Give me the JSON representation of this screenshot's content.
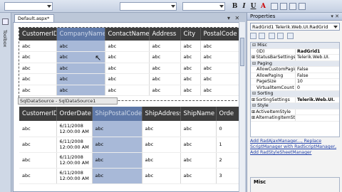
{
  "toolbar": {
    "format_buttons": [
      "B",
      "I",
      "U",
      "A"
    ]
  },
  "toolbox": {
    "label": "Toolbox"
  },
  "document": {
    "tab_title": "Default.aspx*",
    "window_controls": "▾ ✕"
  },
  "grid1": {
    "columns": [
      "CustomerID",
      "CompanyName",
      "ContactName",
      "Address",
      "City",
      "PostalCode"
    ],
    "selected_column": 1,
    "rows": [
      [
        "abc",
        "abc",
        "abc",
        "abc",
        "abc",
        "abc"
      ],
      [
        "abc",
        "abc",
        "abc",
        "abc",
        "abc",
        "abc"
      ],
      [
        "abc",
        "abc",
        "abc",
        "abc",
        "abc",
        "abc"
      ],
      [
        "abc",
        "abc",
        "abc",
        "abc",
        "abc",
        "abc"
      ],
      [
        "abc",
        "abc",
        "abc",
        "abc",
        "abc",
        "abc"
      ]
    ]
  },
  "datasource": {
    "label": "SqlDataSource - SqlDataSource1"
  },
  "grid2": {
    "columns": [
      "CustomerID",
      "OrderDate",
      "ShipPostalCode",
      "ShipAddress",
      "ShipName",
      "Orde"
    ],
    "selected_column": 2,
    "rows": [
      [
        "abc",
        "6/11/2008\n12:00:00 AM",
        "abc",
        "abc",
        "abc",
        "0"
      ],
      [
        "abc",
        "6/11/2008\n12:00:00 AM",
        "abc",
        "abc",
        "abc",
        "1"
      ],
      [
        "abc",
        "6/11/2008\n12:00:00 AM",
        "abc",
        "abc",
        "abc",
        "2"
      ],
      [
        "abc",
        "6/11/2008\n12:00:00 AM",
        "abc",
        "abc",
        "abc",
        "3"
      ]
    ]
  },
  "properties": {
    "title": "Properties",
    "title_controls": "▾ ✕",
    "object": "RadGrid1 Telerik.Web.UI.RadGrid",
    "rows": [
      {
        "type": "cat",
        "name": "Misc"
      },
      {
        "name": "(ID)",
        "value": "RadGrid1",
        "bold": true
      },
      {
        "name": "StatusBarSettings",
        "value": "Telerik.Web.UI.",
        "exp": true
      },
      {
        "type": "cat",
        "name": "Paging"
      },
      {
        "name": "AllowCustomPagin",
        "value": "False"
      },
      {
        "name": "AllowPaging",
        "value": "False"
      },
      {
        "name": "PageSize",
        "value": "10"
      },
      {
        "name": "VirtualItemCount",
        "value": "0"
      },
      {
        "type": "cat",
        "name": "Sorting"
      },
      {
        "name": "SortingSettings",
        "value": "Telerik.Web.UI.",
        "bold": true,
        "exp": true
      },
      {
        "type": "cat",
        "name": "Style"
      },
      {
        "name": "ActiveItemStyle",
        "value": "",
        "exp": true
      },
      {
        "name": "AlternatingItemStyle",
        "value": "",
        "exp": true
      }
    ],
    "links": [
      "Add RadAjaxManager...",
      "Replace ScriptManager with RadScriptManager",
      "Add RadStyleSheetManager"
    ],
    "description_title": "Misc"
  }
}
